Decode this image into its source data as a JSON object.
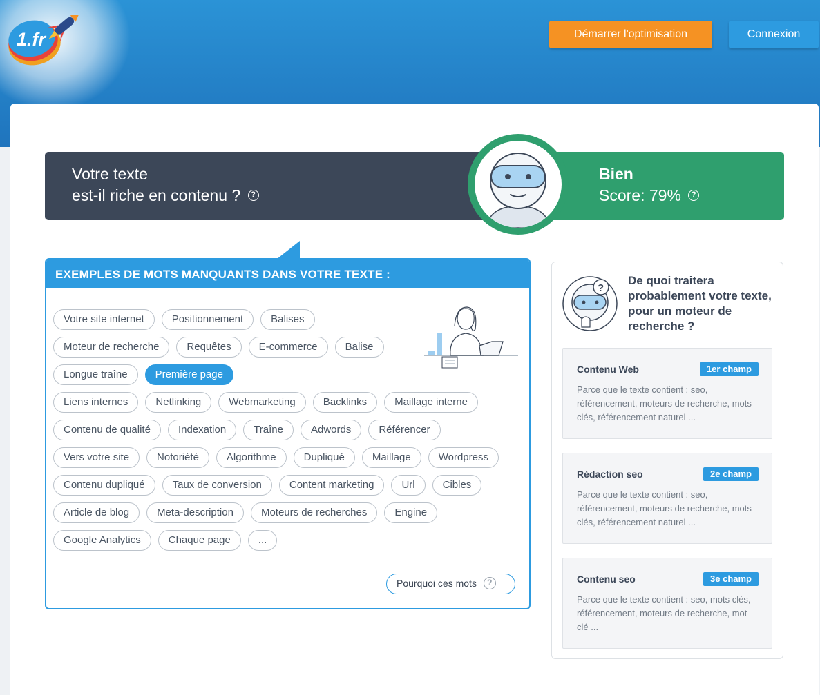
{
  "header": {
    "logo_text": "1.fr",
    "start_button": "Démarrer l'optimisation",
    "login_button": "Connexion"
  },
  "score": {
    "question_line1": "Votre texte",
    "question_line2": "est-il riche en contenu ?",
    "grade": "Bien",
    "score_text": "Score: 79%",
    "percent": 79,
    "help_symbol": "?"
  },
  "missing_words": {
    "title": "EXEMPLES DE MOTS MANQUANTS DANS VOTRE TEXTE :",
    "tags": [
      {
        "label": "Votre site internet",
        "active": false
      },
      {
        "label": "Positionnement",
        "active": false
      },
      {
        "label": "Balises",
        "active": false
      },
      {
        "label": "Moteur de recherche",
        "active": false
      },
      {
        "label": "Requêtes",
        "active": false
      },
      {
        "label": "E-commerce",
        "active": false
      },
      {
        "label": "Balise",
        "active": false
      },
      {
        "label": "Longue traîne",
        "active": false
      },
      {
        "label": "Première page",
        "active": true
      },
      {
        "label": "Liens internes",
        "active": false
      },
      {
        "label": "Netlinking",
        "active": false
      },
      {
        "label": "Webmarketing",
        "active": false
      },
      {
        "label": "Backlinks",
        "active": false
      },
      {
        "label": "Maillage interne",
        "active": false
      },
      {
        "label": "Contenu de qualité",
        "active": false
      },
      {
        "label": "Indexation",
        "active": false
      },
      {
        "label": "Traîne",
        "active": false
      },
      {
        "label": "Adwords",
        "active": false
      },
      {
        "label": "Référencer",
        "active": false
      },
      {
        "label": "Vers votre site",
        "active": false
      },
      {
        "label": "Notoriété",
        "active": false
      },
      {
        "label": "Algorithme",
        "active": false
      },
      {
        "label": "Dupliqué",
        "active": false
      },
      {
        "label": "Maillage",
        "active": false
      },
      {
        "label": "Wordpress",
        "active": false
      },
      {
        "label": "Contenu dupliqué",
        "active": false
      },
      {
        "label": "Taux de conversion",
        "active": false
      },
      {
        "label": "Content marketing",
        "active": false
      },
      {
        "label": "Url",
        "active": false
      },
      {
        "label": "Cibles",
        "active": false
      },
      {
        "label": "Article de blog",
        "active": false
      },
      {
        "label": "Meta-description",
        "active": false
      },
      {
        "label": "Moteurs de recherches",
        "active": false
      },
      {
        "label": "Engine",
        "active": false
      },
      {
        "label": "Google Analytics",
        "active": false
      },
      {
        "label": "Chaque page",
        "active": false
      },
      {
        "label": "...",
        "active": false
      }
    ],
    "why_button": "Pourquoi ces mots",
    "help_symbol": "?"
  },
  "topics": {
    "title": "De quoi traitera probablement votre texte, pour un moteur de recherche ?",
    "items": [
      {
        "name": "Contenu Web",
        "badge": "1er champ",
        "description": "Parce que le texte contient :   seo, référencement, moteurs de recherche, mots clés, référencement naturel ..."
      },
      {
        "name": "Rédaction seo",
        "badge": "2e champ",
        "description": "Parce que le texte contient :   seo, référencement, moteurs de recherche, mots clés, référencement naturel ..."
      },
      {
        "name": "Contenu seo",
        "badge": "3e champ",
        "description": "Parce que le texte contient :   seo, mots clés, référencement, moteurs de recherche, mot clé ..."
      }
    ]
  },
  "colors": {
    "banner": "#1f74bd",
    "accent_blue": "#2d9be0",
    "orange": "#f59223",
    "dark_panel": "#3c4758",
    "green": "#2f9f6e"
  },
  "icons": {
    "logo": "1fr-rocket-logo",
    "robot": "robot-face-icon",
    "thinking_robot": "thinking-robot-icon",
    "illustration": "woman-laptop-illustration",
    "help": "help-circle-icon"
  }
}
